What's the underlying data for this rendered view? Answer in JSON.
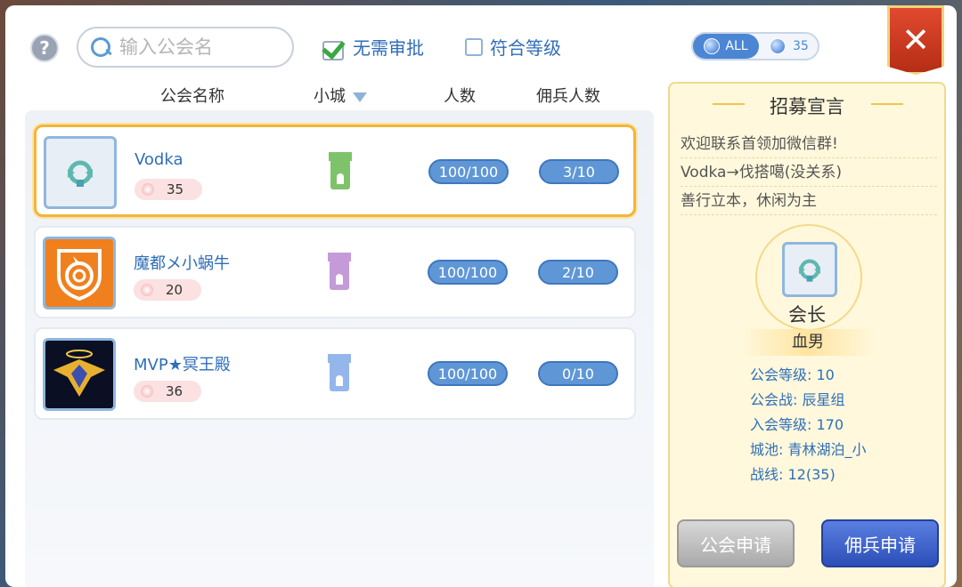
{
  "search": {
    "placeholder": "输入公会名"
  },
  "filters": {
    "no_approval": "无需审批",
    "match_level": "符合等级"
  },
  "scope_toggle": {
    "all": "ALL",
    "server": "35"
  },
  "close_label": "✕",
  "help_label": "?",
  "columns": {
    "name": "公会名称",
    "city": "小城",
    "members": "人数",
    "mercenaries": "佣兵人数"
  },
  "guilds": [
    {
      "name": "Vodka",
      "level": "35",
      "members": "100/100",
      "mercenaries": "3/10",
      "tower_color": "#7ec36a",
      "selected": true
    },
    {
      "name": "魔都メ小蜗牛",
      "level": "20",
      "members": "100/100",
      "mercenaries": "2/10",
      "tower_color": "#c49ad8",
      "selected": false
    },
    {
      "name": "MVP★冥王殿",
      "level": "36",
      "members": "100/100",
      "mercenaries": "0/10",
      "tower_color": "#94b6ea",
      "selected": false
    }
  ],
  "recruit": {
    "title": "招募宣言",
    "manifesto": [
      "欢迎联系首领加微信群!",
      "Vodka→伐搭噶(没关系)",
      "善行立本，休闲为主"
    ],
    "leader_role": "会长",
    "leader_name": "血男",
    "info": [
      "公会等级: 10",
      "公会战: 辰星组",
      "入会等级: 170",
      "城池: 青林湖泊_小",
      "战线: 12(35)"
    ],
    "btn_guild_apply": "公会申请",
    "btn_merc_apply": "佣兵申请"
  }
}
